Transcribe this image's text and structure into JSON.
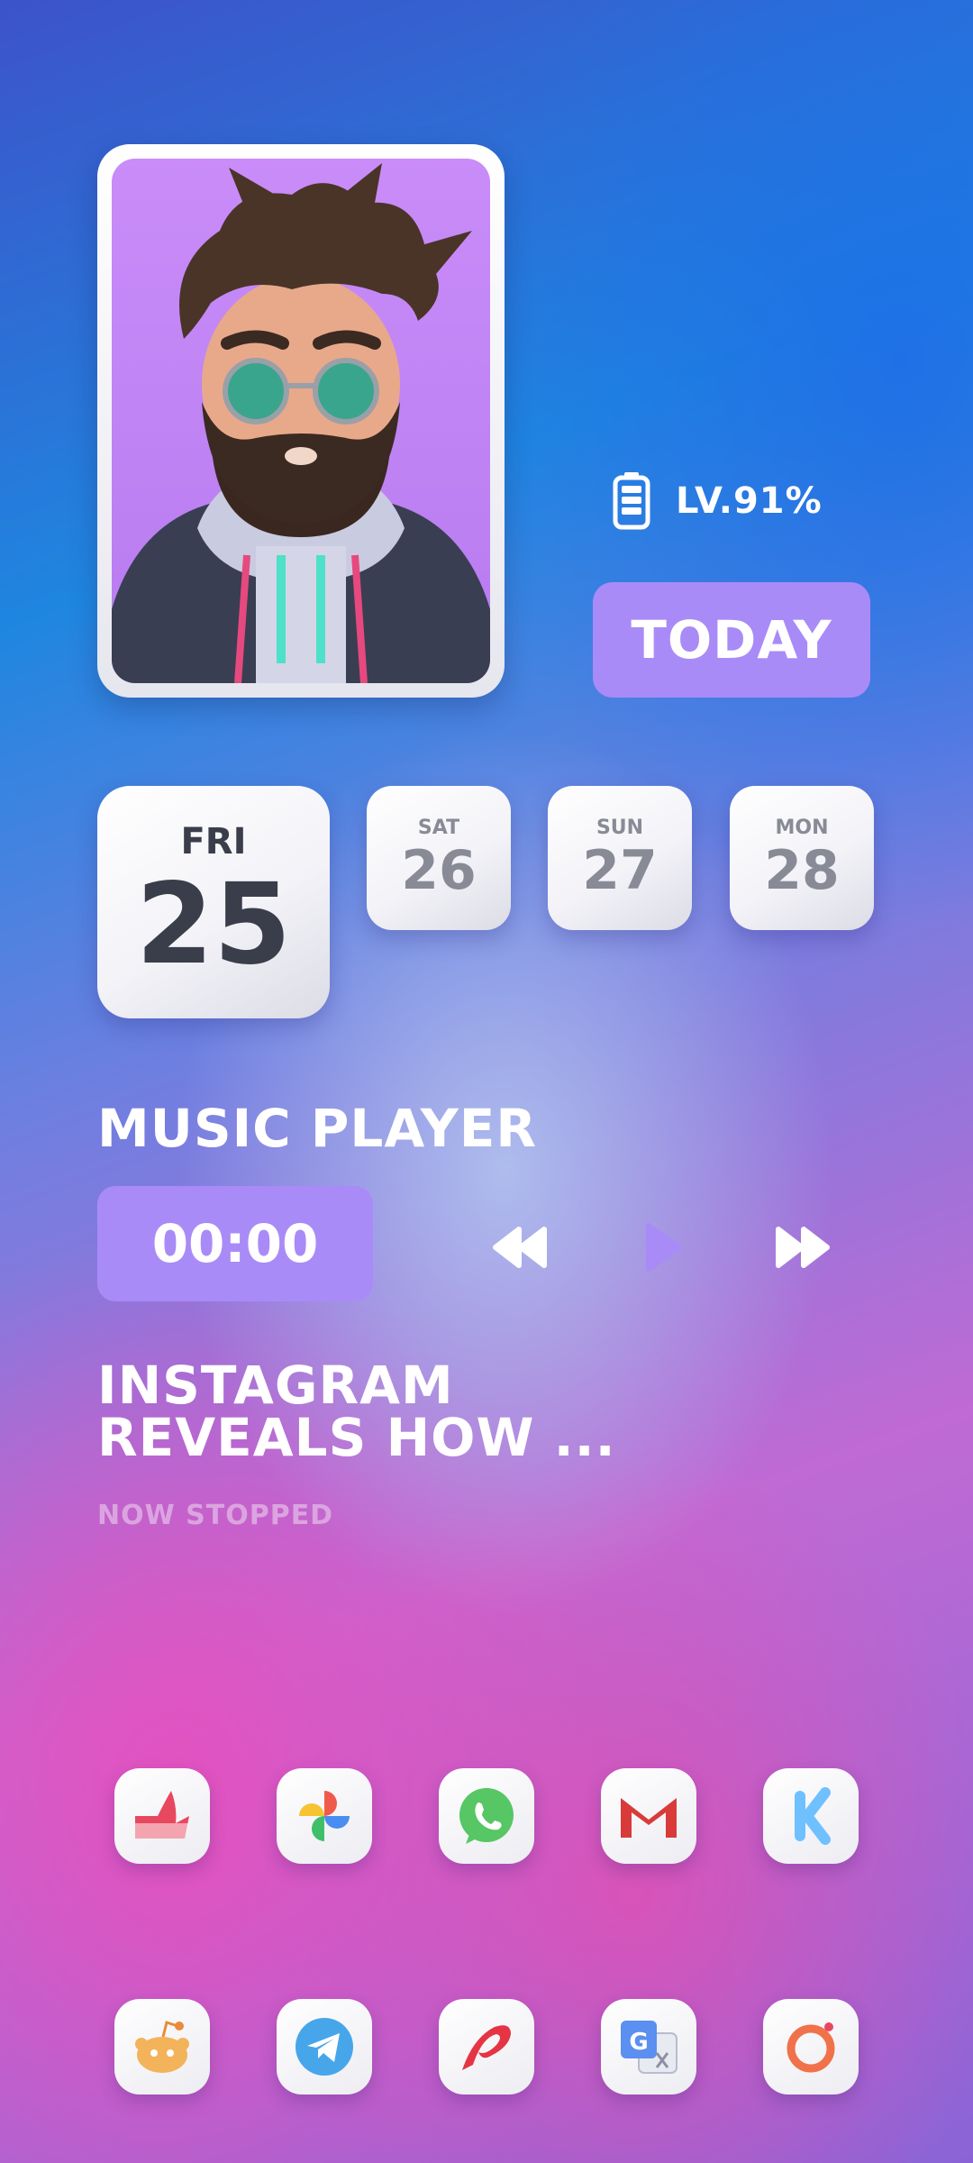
{
  "battery": {
    "label": "LV.91%"
  },
  "today_button": {
    "label": "TODAY"
  },
  "calendar": {
    "today": {
      "day": "FRI",
      "date": "25"
    },
    "upcoming": [
      {
        "day": "SAT",
        "date": "26"
      },
      {
        "day": "SUN",
        "date": "27"
      },
      {
        "day": "MON",
        "date": "28"
      }
    ]
  },
  "music": {
    "title": "MUSIC PLAYER",
    "time": "00:00",
    "track_line1": "INSTAGRAM",
    "track_line2": "REVEALS HOW ...",
    "status": "NOW STOPPED"
  },
  "apps_row1": [
    "photos-red-icon",
    "google-photos-icon",
    "whatsapp-icon",
    "gmail-icon",
    "kustom-icon"
  ],
  "apps_row2": [
    "reddit-icon",
    "telegram-icon",
    "airtel-icon",
    "google-translate-icon",
    "camera-ring-icon"
  ],
  "colors": {
    "accent": "#a98bf7",
    "tile_text": "#3a3d4a",
    "tile_text_muted": "#888b96",
    "status_text": "#dba4e0"
  }
}
